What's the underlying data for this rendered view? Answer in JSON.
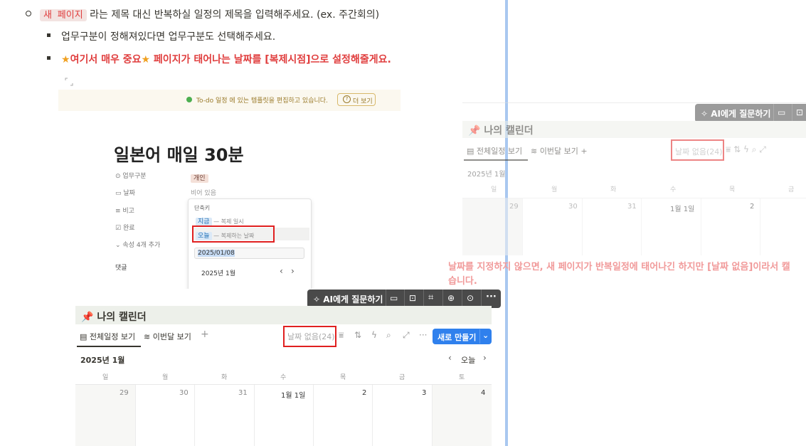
{
  "bullets": {
    "line1_code": "새 페이지",
    "line1_rest": "라는 제목 대신 반복하실 일정의 제목을 입력해주세요. (ex. 주간회의)",
    "line2": "업무구분이 정해져있다면 업무구분도 선택해주세요.",
    "line3_star1": "★",
    "line3_part1": "여기서 매우 중요",
    "line3_star2": "★",
    "line3_part2": " 페이지가 태어나는 날짜를 [복제시점]으로 설정해줄게요."
  },
  "template_shot": {
    "banner_text": "To-do 일정  에 있는 템플릿을 편집하고 있습니다.",
    "banner_button": "더 보기",
    "page_title": "일본어 매일 30분",
    "props": [
      {
        "label": "업무구분",
        "value": "개인"
      },
      {
        "label": "날짜",
        "value": "비어 있음"
      },
      {
        "label": "비고",
        "value": ""
      },
      {
        "label": "완료",
        "value": ""
      },
      {
        "label": "속성 4개 추가",
        "value": ""
      }
    ],
    "comment_label": "댓글",
    "popup": {
      "header": "단축키",
      "opt1_chip": "지금",
      "opt1_desc": "— 복제 일시",
      "opt2_chip": "오늘",
      "opt2_desc": "— 복제하는 날짜",
      "date_value": "2025/01/08",
      "month": "2025년 1월",
      "prev": "‹",
      "next": "›"
    }
  },
  "toolbar": {
    "ai_label": "AI에게 질문하기",
    "icons": [
      "comment-icon",
      "caption-icon",
      "crop-icon",
      "zoom-icon",
      "download-icon",
      "more-icon"
    ]
  },
  "calendar": {
    "title_icon": "📌",
    "title": "나의 캘린더",
    "view_all": "전체일정 보기",
    "view_month": "이번달 보기",
    "add_view": "+",
    "no_date": "날짜 없음(24)",
    "new_button": "새로 만들기",
    "month_label": "2025년 1월",
    "today": "오늘",
    "weekdays": [
      "일",
      "월",
      "화",
      "수",
      "목",
      "금",
      "토"
    ],
    "dates": [
      "29",
      "30",
      "31",
      "1월 1일",
      "2",
      "3",
      "4"
    ]
  },
  "ghost_calendar": {
    "ai_label": "AI에게 질문하기",
    "title_icon": "📌",
    "title": "나의 캘린더",
    "view_all": "전체일정 보기",
    "view_month": "이번달 보기",
    "no_date": "날짜 없음(24)",
    "month_label": "2025년 1월",
    "weekdays": [
      "일",
      "월",
      "화",
      "수",
      "목",
      "금"
    ],
    "dates": [
      "29",
      "30",
      "31",
      "1월 1일",
      "2"
    ]
  },
  "note_text_line1": "날짜를 지정하지 않으면, 새 페이지가 반복일정에 태어나긴 하지만 [날짜 없음]이라서 캘",
  "note_text_line2": "습니다.",
  "colors": {
    "accent_red": "#e03e3e",
    "blue_button": "#2f80ed",
    "divider": "#a9c8f0"
  }
}
